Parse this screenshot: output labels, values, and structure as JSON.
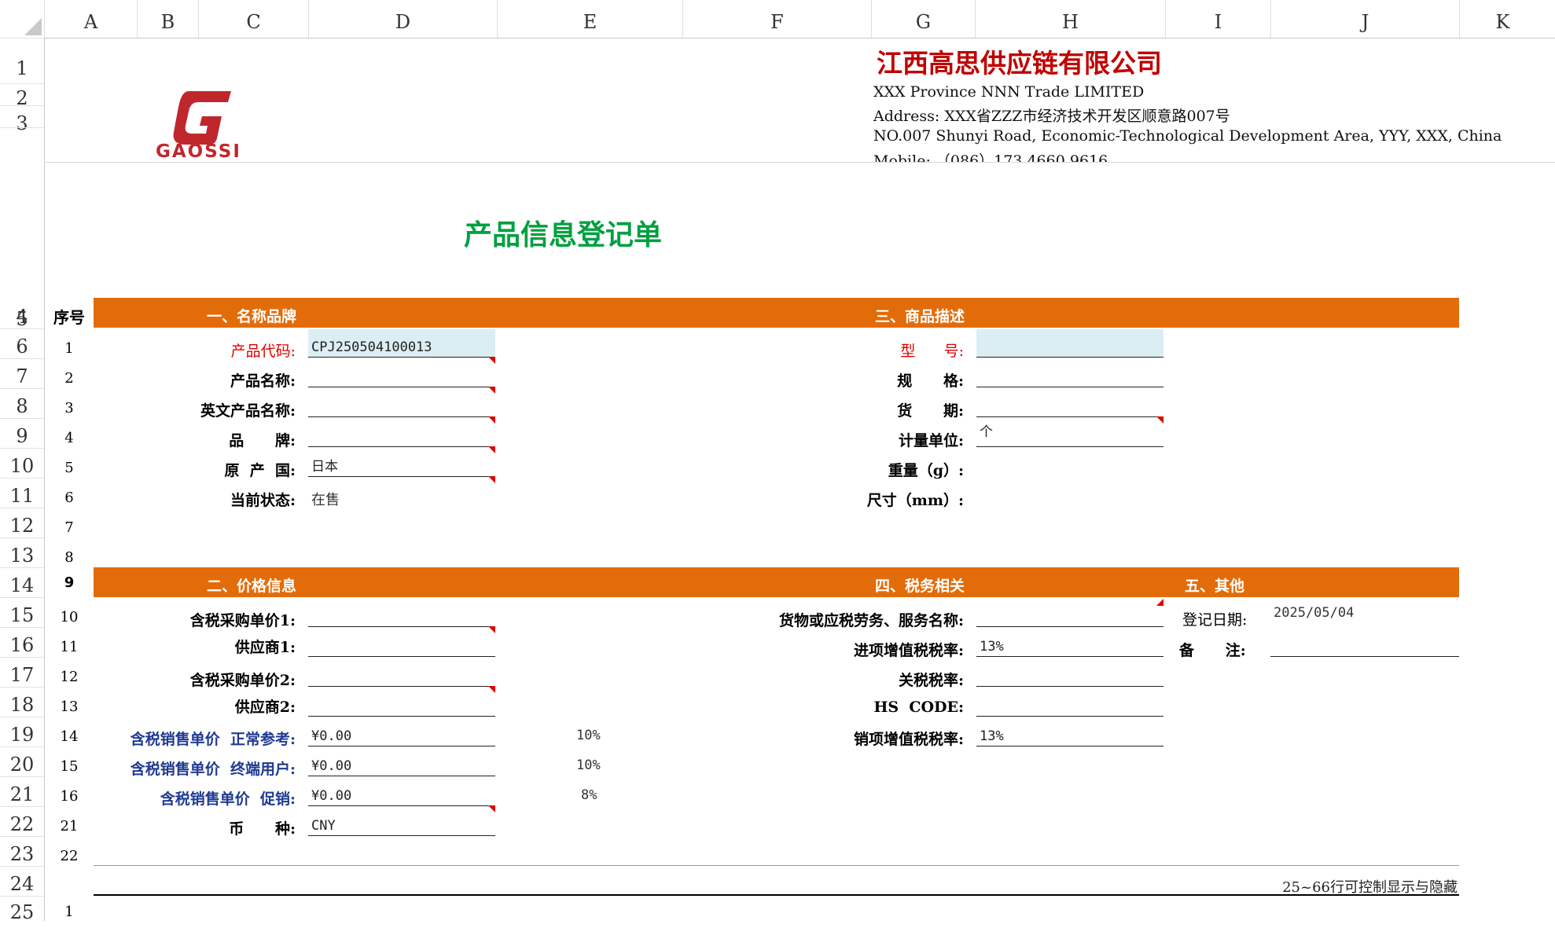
{
  "columns": [
    "A",
    "B",
    "C",
    "D",
    "E",
    "F",
    "G",
    "H",
    "I",
    "J",
    "K"
  ],
  "rows": [
    "1",
    "2",
    "3",
    "4",
    "5",
    "6",
    "7",
    "8",
    "9",
    "10",
    "11",
    "12",
    "13",
    "14",
    "15",
    "16",
    "17",
    "18",
    "19",
    "20",
    "21",
    "22",
    "23",
    "24",
    "25"
  ],
  "logo": {
    "text": "GAOSSI",
    "color": "#c0272d"
  },
  "company": {
    "name_cn": "江西高思供应链有限公司",
    "name_en": "XXX Province NNN Trade LIMITED",
    "address_cn": "Address:  XXX省ZZZ市经济技术开发区顺意路007号",
    "address_en": "NO.007 Shunyi Road, Economic-Technological Development Area, YYY, XXX, China",
    "mobile": "Mobile:  （086）173 4660 9616"
  },
  "form_title": "产品信息登记单",
  "sections": {
    "seq_header": "序号",
    "name_brand": "一、名称品牌",
    "product_desc": "三、商品描述",
    "price_info": "二、价格信息",
    "tax": "四、税务相关",
    "other": "五、其他"
  },
  "seq_numbers": {
    "r6": "1",
    "r7": "2",
    "r8": "3",
    "r9": "4",
    "r10": "5",
    "r11": "6",
    "r12": "7",
    "r13": "8",
    "r14": "9",
    "r15": "10",
    "r16": "11",
    "r17": "12",
    "r18": "13",
    "r19": "14",
    "r20": "15",
    "r21": "16",
    "r22": "21",
    "r23": "22",
    "r25": "1"
  },
  "name_brand": {
    "product_code_label": "产品代码:",
    "product_code_value": "CPJ250504100013",
    "product_name_label": "产品名称:",
    "english_name_label": "英文产品名称:",
    "brand_label": "品      牌:",
    "origin_label": "原  产  国:",
    "origin_value": "日本",
    "status_label": "当前状态:",
    "status_value": "在售"
  },
  "product_desc": {
    "model_label": "型      号:",
    "spec_label": "规      格:",
    "lead_time_label": "货      期:",
    "unit_label": "计量单位:",
    "unit_value": "个",
    "weight_label": "重量（g）:",
    "size_label": "尺寸（mm）:"
  },
  "price": {
    "purchase_price1_label": "含税采购单价1:",
    "supplier1_label": "供应商1:",
    "purchase_price2_label": "含税采购单价2:",
    "supplier2_label": "供应商2:",
    "sale_normal_label": "含税销售单价  正常参考:",
    "sale_normal_value": "¥0.00",
    "sale_normal_pct": "10%",
    "sale_end_label": "含税销售单价  终端用户:",
    "sale_end_value": "¥0.00",
    "sale_end_pct": "10%",
    "sale_promo_label": "含税销售单价  促销:",
    "sale_promo_value": "¥0.00",
    "sale_promo_pct": "8%",
    "currency_label": "币      种:",
    "currency_value": "CNY"
  },
  "tax": {
    "goods_service_label": "货物或应税劳务、服务名称:",
    "input_vat_label": "进项增值税税率:",
    "input_vat_value": "13%",
    "tariff_label": "关税税率:",
    "hs_code_label": "HS  CODE:",
    "output_vat_label": "销项增值税税率:",
    "output_vat_value": "13%"
  },
  "other": {
    "reg_date_label": "登记日期:",
    "reg_date_value": "2025/05/04",
    "remark_label": "备      注:"
  },
  "footer_note": "25~66行可控制显示与隐藏",
  "colors": {
    "band": "#e36c0a",
    "title_green": "#00a040",
    "company_red": "#c00000",
    "highlight": "#dbeef4"
  }
}
